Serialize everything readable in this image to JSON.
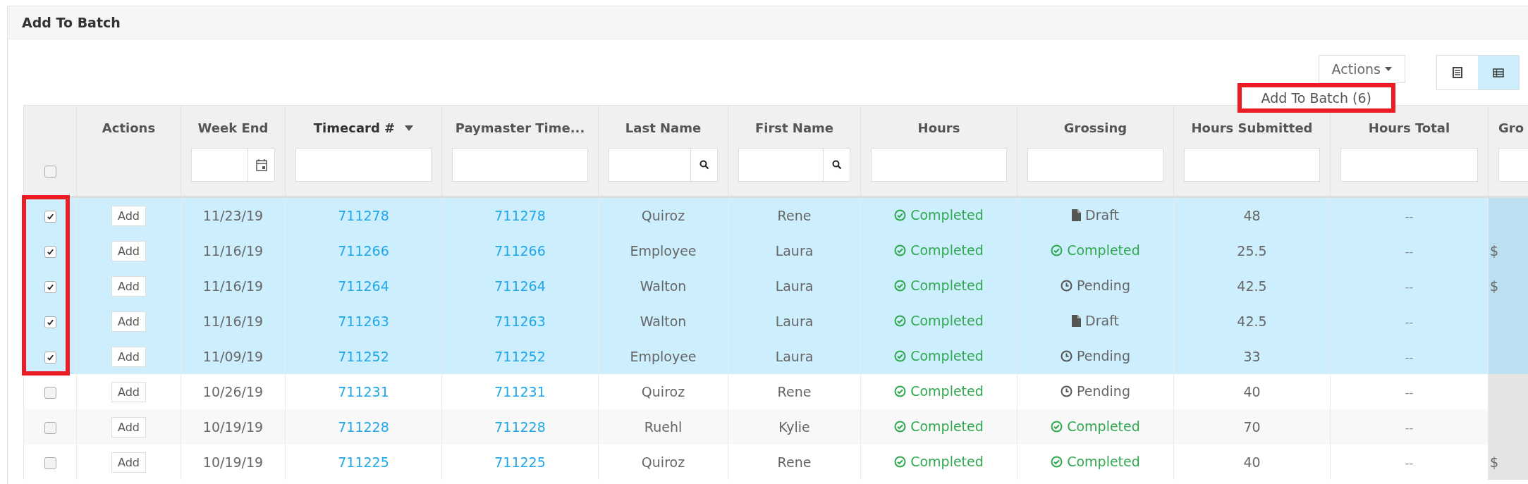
{
  "panel": {
    "title": "Add To Batch"
  },
  "toolbar": {
    "actions_button": "Actions",
    "view_toggle": [
      {
        "kind": "list",
        "selected": false
      },
      {
        "kind": "table",
        "selected": true
      }
    ]
  },
  "dropdown": {
    "items": [
      "Add To Batch (6)"
    ]
  },
  "table": {
    "select_all": {
      "checked": false
    },
    "columns": [
      {
        "label": "Actions",
        "kind": "none",
        "sorted": false
      },
      {
        "label": "Week End",
        "kind": "date",
        "sorted": false
      },
      {
        "label": "Timecard #",
        "kind": "text",
        "sorted": true
      },
      {
        "label": "Paymaster Time...",
        "kind": "text",
        "sorted": false
      },
      {
        "label": "Last Name",
        "kind": "search",
        "sorted": false
      },
      {
        "label": "First Name",
        "kind": "search",
        "sorted": false
      },
      {
        "label": "Hours",
        "kind": "text",
        "sorted": false
      },
      {
        "label": "Grossing",
        "kind": "text",
        "sorted": false
      },
      {
        "label": "Hours Submitted",
        "kind": "text",
        "sorted": false
      },
      {
        "label": "Hours Total",
        "kind": "text",
        "sorted": false
      },
      {
        "label": "Gro",
        "kind": "text",
        "sorted": false
      }
    ],
    "rows": [
      {
        "selected": true,
        "checked": true,
        "action": "Add",
        "week_end": "11/23/19",
        "timecard": "711278",
        "paymaster": "711278",
        "last": "Quiroz",
        "first": "Rene",
        "hours": {
          "kind": "completed",
          "text": "Completed"
        },
        "grossing": {
          "kind": "draft",
          "text": "Draft"
        },
        "submitted": "48",
        "total": "--"
      },
      {
        "selected": true,
        "checked": true,
        "action": "Add",
        "week_end": "11/16/19",
        "timecard": "711266",
        "paymaster": "711266",
        "last": "Employee",
        "first": "Laura",
        "hours": {
          "kind": "completed",
          "text": "Completed"
        },
        "grossing": {
          "kind": "completed",
          "text": "Completed"
        },
        "submitted": "25.5",
        "total": "--",
        "column_12": "$"
      },
      {
        "selected": true,
        "checked": true,
        "action": "Add",
        "week_end": "11/16/19",
        "timecard": "711264",
        "paymaster": "711264",
        "last": "Walton",
        "first": "Laura",
        "hours": {
          "kind": "completed",
          "text": "Completed"
        },
        "grossing": {
          "kind": "pending",
          "text": "Pending"
        },
        "submitted": "42.5",
        "total": "--",
        "column_12": "$"
      },
      {
        "selected": true,
        "checked": true,
        "action": "Add",
        "week_end": "11/16/19",
        "timecard": "711263",
        "paymaster": "711263",
        "last": "Walton",
        "first": "Laura",
        "hours": {
          "kind": "completed",
          "text": "Completed"
        },
        "grossing": {
          "kind": "draft",
          "text": "Draft"
        },
        "submitted": "42.5",
        "total": "--"
      },
      {
        "selected": true,
        "checked": true,
        "action": "Add",
        "week_end": "11/09/19",
        "timecard": "711252",
        "paymaster": "711252",
        "last": "Employee",
        "first": "Laura",
        "hours": {
          "kind": "completed",
          "text": "Completed"
        },
        "grossing": {
          "kind": "pending",
          "text": "Pending"
        },
        "submitted": "33",
        "total": "--"
      },
      {
        "selected": false,
        "checked": false,
        "action": "Add",
        "week_end": "10/26/19",
        "timecard": "711231",
        "paymaster": "711231",
        "last": "Quiroz",
        "first": "Rene",
        "hours": {
          "kind": "completed",
          "text": "Completed"
        },
        "grossing": {
          "kind": "pending",
          "text": "Pending"
        },
        "submitted": "40",
        "total": "--"
      },
      {
        "selected": false,
        "checked": false,
        "action": "Add",
        "week_end": "10/19/19",
        "timecard": "711228",
        "paymaster": "711228",
        "last": "Ruehl",
        "first": "Kylie",
        "hours": {
          "kind": "completed",
          "text": "Completed"
        },
        "grossing": {
          "kind": "completed",
          "text": "Completed"
        },
        "submitted": "70",
        "total": "--"
      },
      {
        "selected": false,
        "checked": false,
        "action": "Add",
        "week_end": "10/19/19",
        "timecard": "711225",
        "paymaster": "711225",
        "last": "Quiroz",
        "first": "Rene",
        "hours": {
          "kind": "completed",
          "text": "Completed"
        },
        "grossing": {
          "kind": "completed",
          "text": "Completed"
        },
        "submitted": "40",
        "total": "--",
        "column_12": "$"
      }
    ]
  }
}
